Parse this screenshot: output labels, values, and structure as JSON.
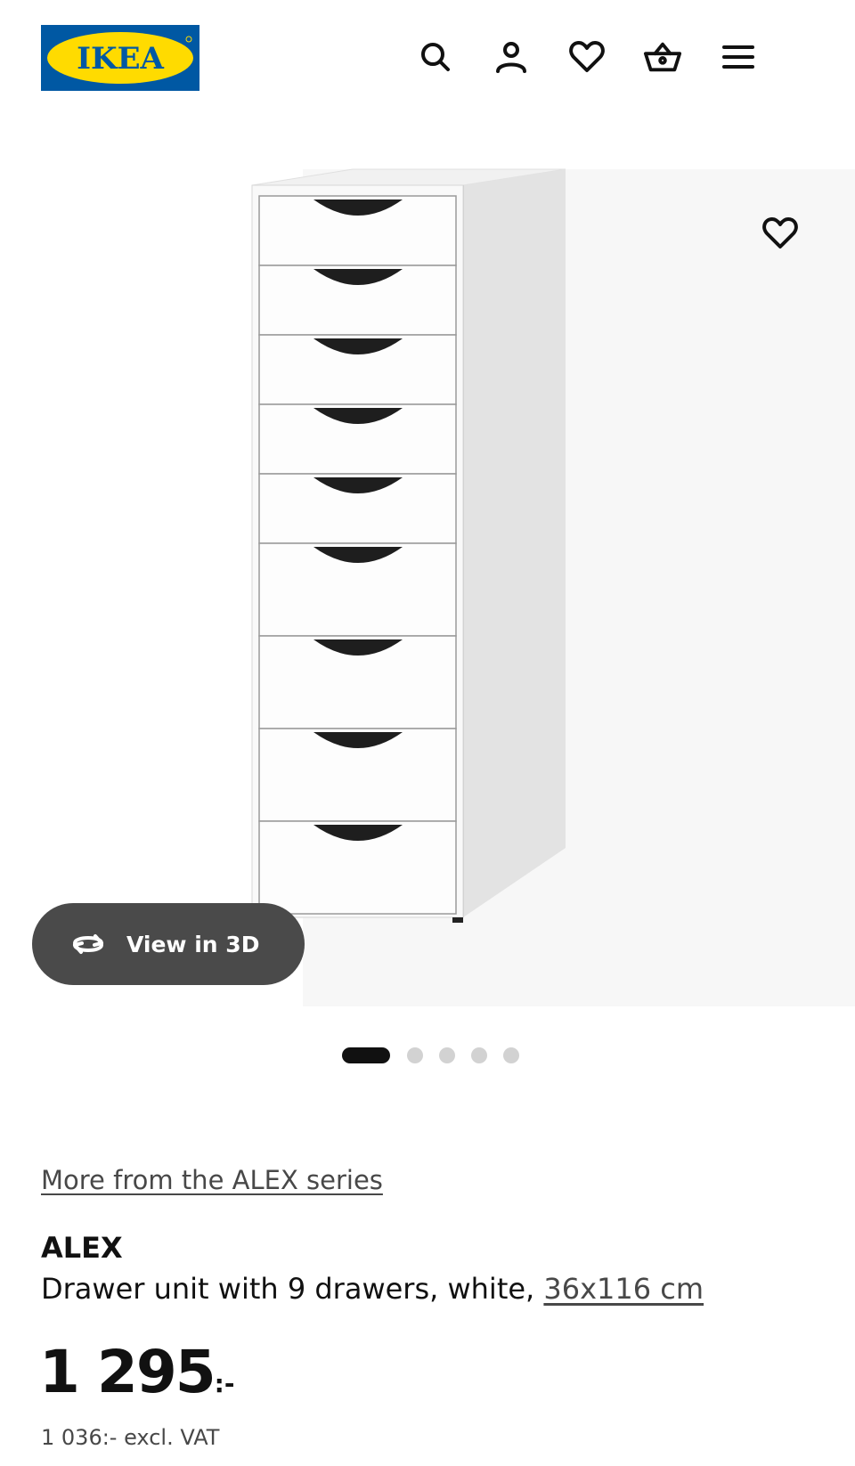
{
  "brand": {
    "logo_text": "IKEA",
    "colors": {
      "blue": "#0058A3",
      "yellow": "#FFDB00"
    }
  },
  "header": {
    "icons": [
      "search-icon",
      "profile-icon",
      "heart-icon",
      "basket-icon",
      "menu-icon"
    ]
  },
  "gallery": {
    "view_3d_label": "View in 3D",
    "image_count": 5,
    "active_index": 0,
    "drawer_count": 9
  },
  "product": {
    "series_link": "More from the ALEX series",
    "name": "ALEX",
    "description": "Drawer unit with 9 drawers, white, ",
    "dimensions": "36x116 cm",
    "price_main": "1 295",
    "price_suffix": ":-",
    "price_excl_vat": "1 036:- excl. VAT"
  }
}
